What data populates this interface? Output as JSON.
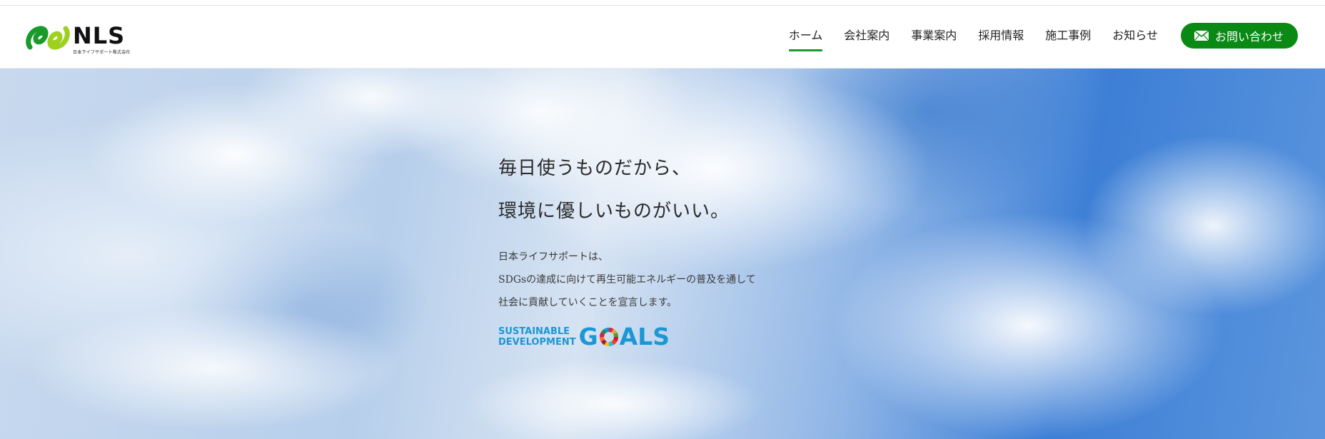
{
  "header": {
    "logo": {
      "text": "NLS",
      "subtext": "日本ライフサポート株式会社",
      "colors": {
        "green": "#1a9a2a",
        "lime": "#9fd020"
      }
    },
    "nav": [
      {
        "label": "ホーム",
        "active": true
      },
      {
        "label": "会社案内",
        "active": false
      },
      {
        "label": "事業案内",
        "active": false
      },
      {
        "label": "採用情報",
        "active": false
      },
      {
        "label": "施工事例",
        "active": false
      },
      {
        "label": "お知らせ",
        "active": false
      }
    ],
    "contact_button": {
      "label": "お問い合わせ",
      "icon": "mail-icon",
      "color": "#0a8a14"
    }
  },
  "hero": {
    "headline_lines": [
      "毎日使うものだから、",
      "環境に優しいものがいい。"
    ],
    "lead_lines": [
      "日本ライフサポートは、",
      "SDGsの達成に向けて再生可能エネルギーの普及を通して",
      "社会に貢献していくことを宣言します。"
    ],
    "sdgs_logo": {
      "line1": "SUSTAINABLE",
      "line2": "DEVELOPMENT",
      "word_start": "G",
      "word_end": "ALS",
      "color": "#1a97d5",
      "icon": "sdgs-wheel-icon"
    }
  }
}
